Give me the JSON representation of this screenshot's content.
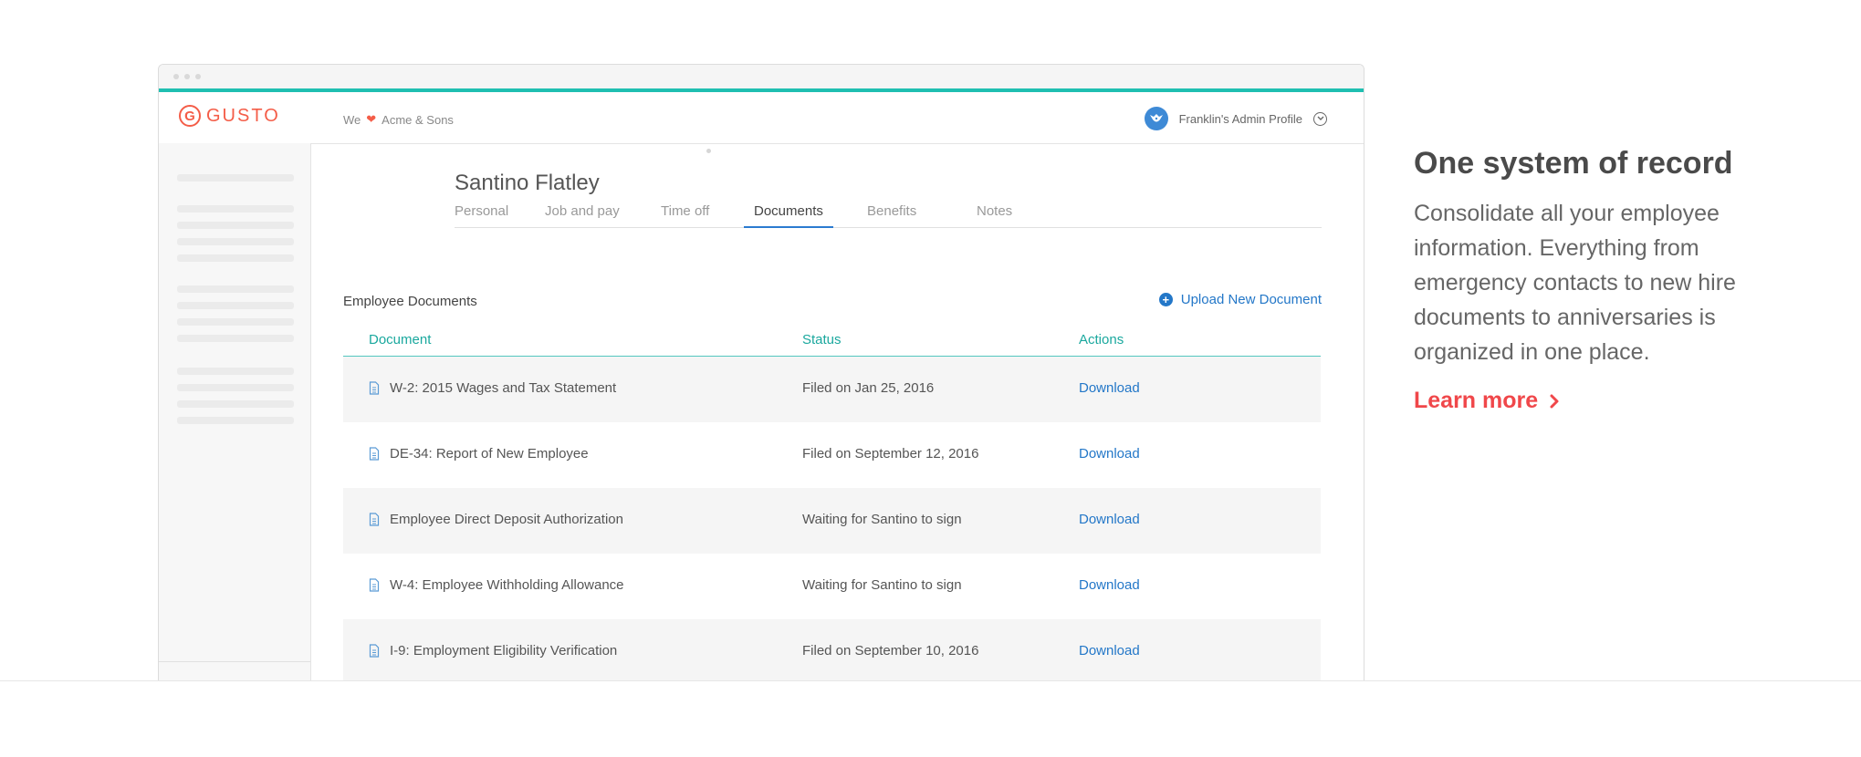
{
  "header": {
    "logo_letter": "G",
    "logo_text": "GUSTO",
    "company_prefix": "We",
    "company_name": "Acme & Sons",
    "profile_label": "Franklin's Admin Profile"
  },
  "employee": {
    "name": "Santino Flatley",
    "tabs": [
      {
        "label": "Personal",
        "active": false
      },
      {
        "label": "Job and pay",
        "active": false
      },
      {
        "label": "Time off",
        "active": false
      },
      {
        "label": "Documents",
        "active": true
      },
      {
        "label": "Benefits",
        "active": false
      },
      {
        "label": "Notes",
        "active": false
      }
    ]
  },
  "documents": {
    "section_title": "Employee Documents",
    "upload_label": "Upload New Document",
    "columns": [
      "Document",
      "Status",
      "Actions"
    ],
    "rows": [
      {
        "name": "W-2: 2015 Wages and Tax Statement",
        "status": "Filed on Jan 25, 2016",
        "action": "Download"
      },
      {
        "name": "DE-34: Report of New Employee",
        "status": "Filed on September 12, 2016",
        "action": "Download"
      },
      {
        "name": "Employee Direct Deposit Authorization",
        "status": "Waiting for Santino to sign",
        "action": "Download"
      },
      {
        "name": "W-4: Employee Withholding Allowance",
        "status": "Waiting for Santino to sign",
        "action": "Download"
      },
      {
        "name": "I-9: Employment Eligibility Verification",
        "status": "Filed on September 10, 2016",
        "action": "Download"
      }
    ]
  },
  "promo": {
    "title": "One system of record",
    "body": "Consolidate all your employee information. Everything from emergency contacts to new hire documents to anniversaries is organized in one place.",
    "link_label": "Learn more"
  },
  "colors": {
    "accent_teal": "#1fbfb1",
    "brand_red": "#f45d48",
    "link_blue": "#2377c8",
    "promo_link_red": "#f0474a"
  }
}
